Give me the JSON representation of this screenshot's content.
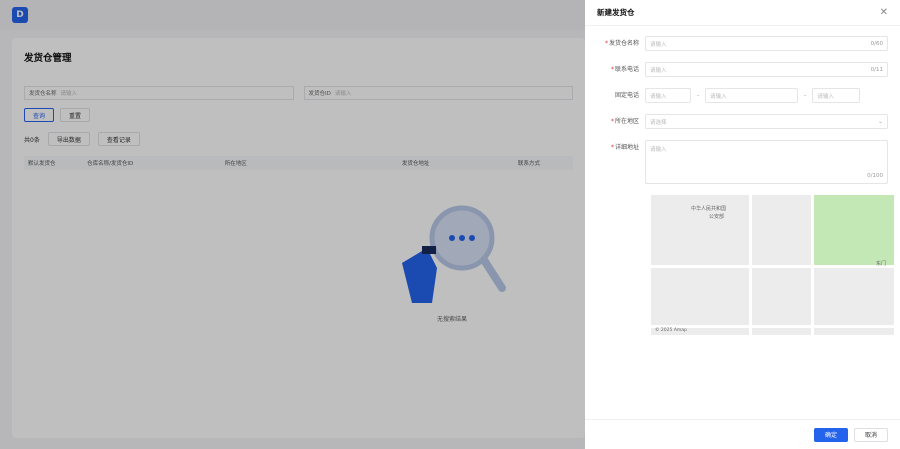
{
  "app": {
    "logo_mark": "D"
  },
  "colors": {
    "accent": "#2463eb",
    "error": "#e33333",
    "map_green": "#c3e8b5"
  },
  "main": {
    "title": "发货仓管理",
    "filters": [
      {
        "label": "发货仓名称",
        "placeholder": "请输入"
      },
      {
        "label": "发货仓ID",
        "placeholder": "请输入"
      }
    ],
    "buttons": {
      "query": "查询",
      "reset": "重置"
    },
    "count": "共0条",
    "export": "导出数据",
    "records": "查看记录",
    "columns": [
      "默认发货仓",
      "仓库名称/发货仓ID",
      "所在地区",
      "发货仓地址",
      "联系方式"
    ],
    "empty_text": "无搜索结果"
  },
  "drawer": {
    "title": "新建发货仓",
    "fields": {
      "name": {
        "label": "发货仓名称",
        "placeholder": "请输入",
        "count": "0/60"
      },
      "contact": {
        "label": "联系电话",
        "placeholder": "请输入",
        "count": "0/11"
      },
      "landline": {
        "label": "固定电话",
        "placeholder": "请输入"
      },
      "region": {
        "label": "所在地区",
        "placeholder": "请选择"
      },
      "address": {
        "label": "详细地址",
        "placeholder": "请输入",
        "count": "0/100"
      }
    },
    "map": {
      "label_1": "中华人民共和国",
      "label_2": "公安部",
      "label_3": "东门",
      "copyright": "© 2025 Amap"
    },
    "footer": {
      "confirm": "确定",
      "cancel": "取消"
    }
  }
}
